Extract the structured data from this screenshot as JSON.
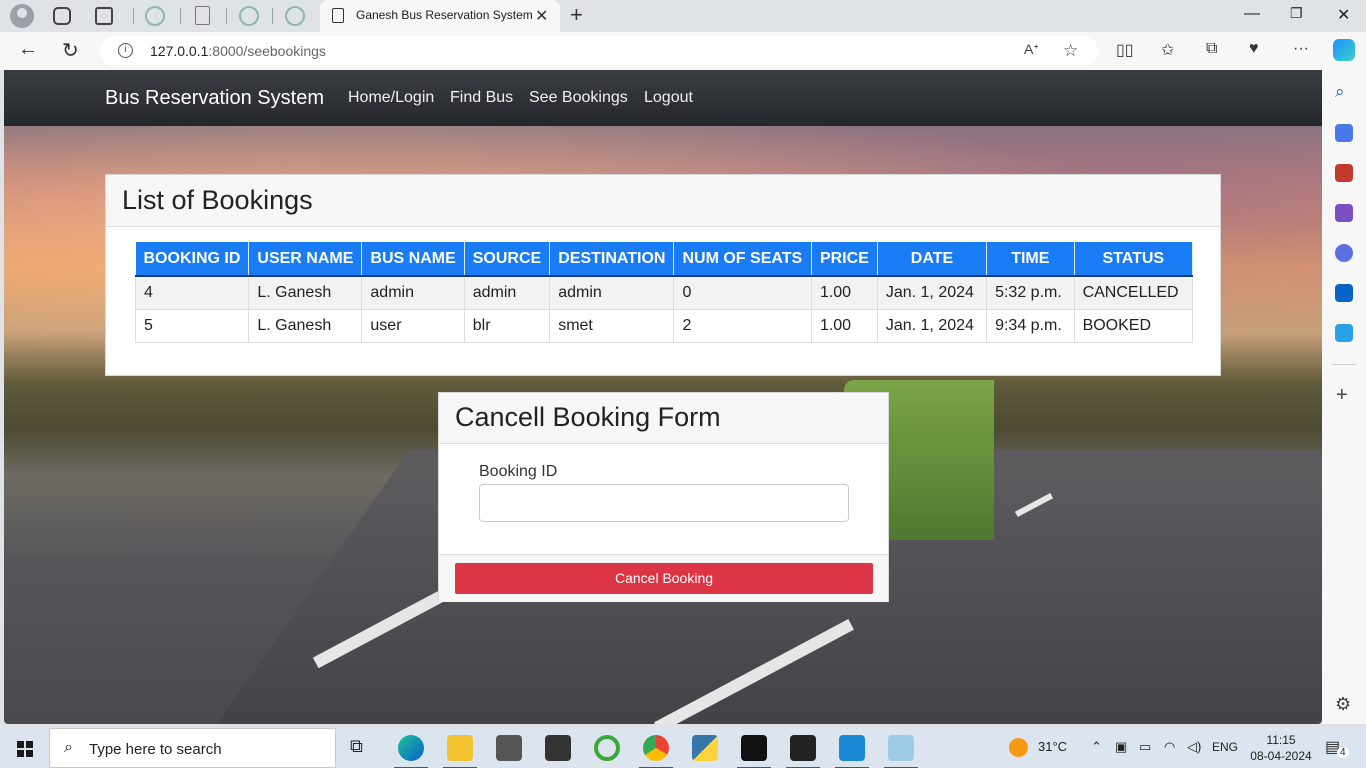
{
  "browser": {
    "active_tab_title": "Ganesh Bus Reservation System",
    "url_host": "127.0.0.1",
    "url_path": ":8000/seebookings"
  },
  "site": {
    "brand": "Bus Reservation System",
    "nav": [
      "Home/Login",
      "Find Bus",
      "See Bookings",
      "Logout"
    ]
  },
  "bookings": {
    "title": "List of Bookings",
    "columns": [
      "BOOKING ID",
      "USER NAME",
      "BUS NAME",
      "SOURCE",
      "DESTINATION",
      "NUM OF SEATS",
      "PRICE",
      "DATE",
      "TIME",
      "STATUS"
    ],
    "rows": [
      [
        "4",
        "L. Ganesh",
        "admin",
        "admin",
        "admin",
        "0",
        "1.00",
        "Jan. 1, 2024",
        "5:32 p.m.",
        "CANCELLED"
      ],
      [
        "5",
        "L. Ganesh",
        "user",
        "blr",
        "smet",
        "2",
        "1.00",
        "Jan. 1, 2024",
        "9:34 p.m.",
        "BOOKED"
      ]
    ]
  },
  "cancel_form": {
    "title": "Cancell Booking Form",
    "label": "Booking ID",
    "input_value": "",
    "button": "Cancel Booking"
  },
  "taskbar": {
    "search_placeholder": "Type here to search",
    "temperature": "31°C",
    "language": "ENG",
    "time": "11:15",
    "date": "08-04-2024",
    "notification_count": "4"
  },
  "colors": {
    "header_blue": "#1a7cf5",
    "danger": "#dc3545",
    "navbar": "#2b2e33"
  },
  "icons": {
    "browser": [
      "profile-icon",
      "workspaces-icon",
      "tab-actions-icon",
      "back-icon",
      "refresh-icon",
      "info-icon",
      "read-aloud-icon",
      "favorite-icon",
      "split-screen-icon",
      "favorites-icon",
      "collections-icon",
      "browser-essentials-icon",
      "more-icon",
      "copilot-icon"
    ],
    "taskbar": [
      "windows-start-icon",
      "search-icon",
      "task-view-icon",
      "edge-icon",
      "file-explorer-icon",
      "mail-icon",
      "terminal-icon",
      "chrome-icon",
      "python-icon",
      "vscode-icon"
    ]
  }
}
